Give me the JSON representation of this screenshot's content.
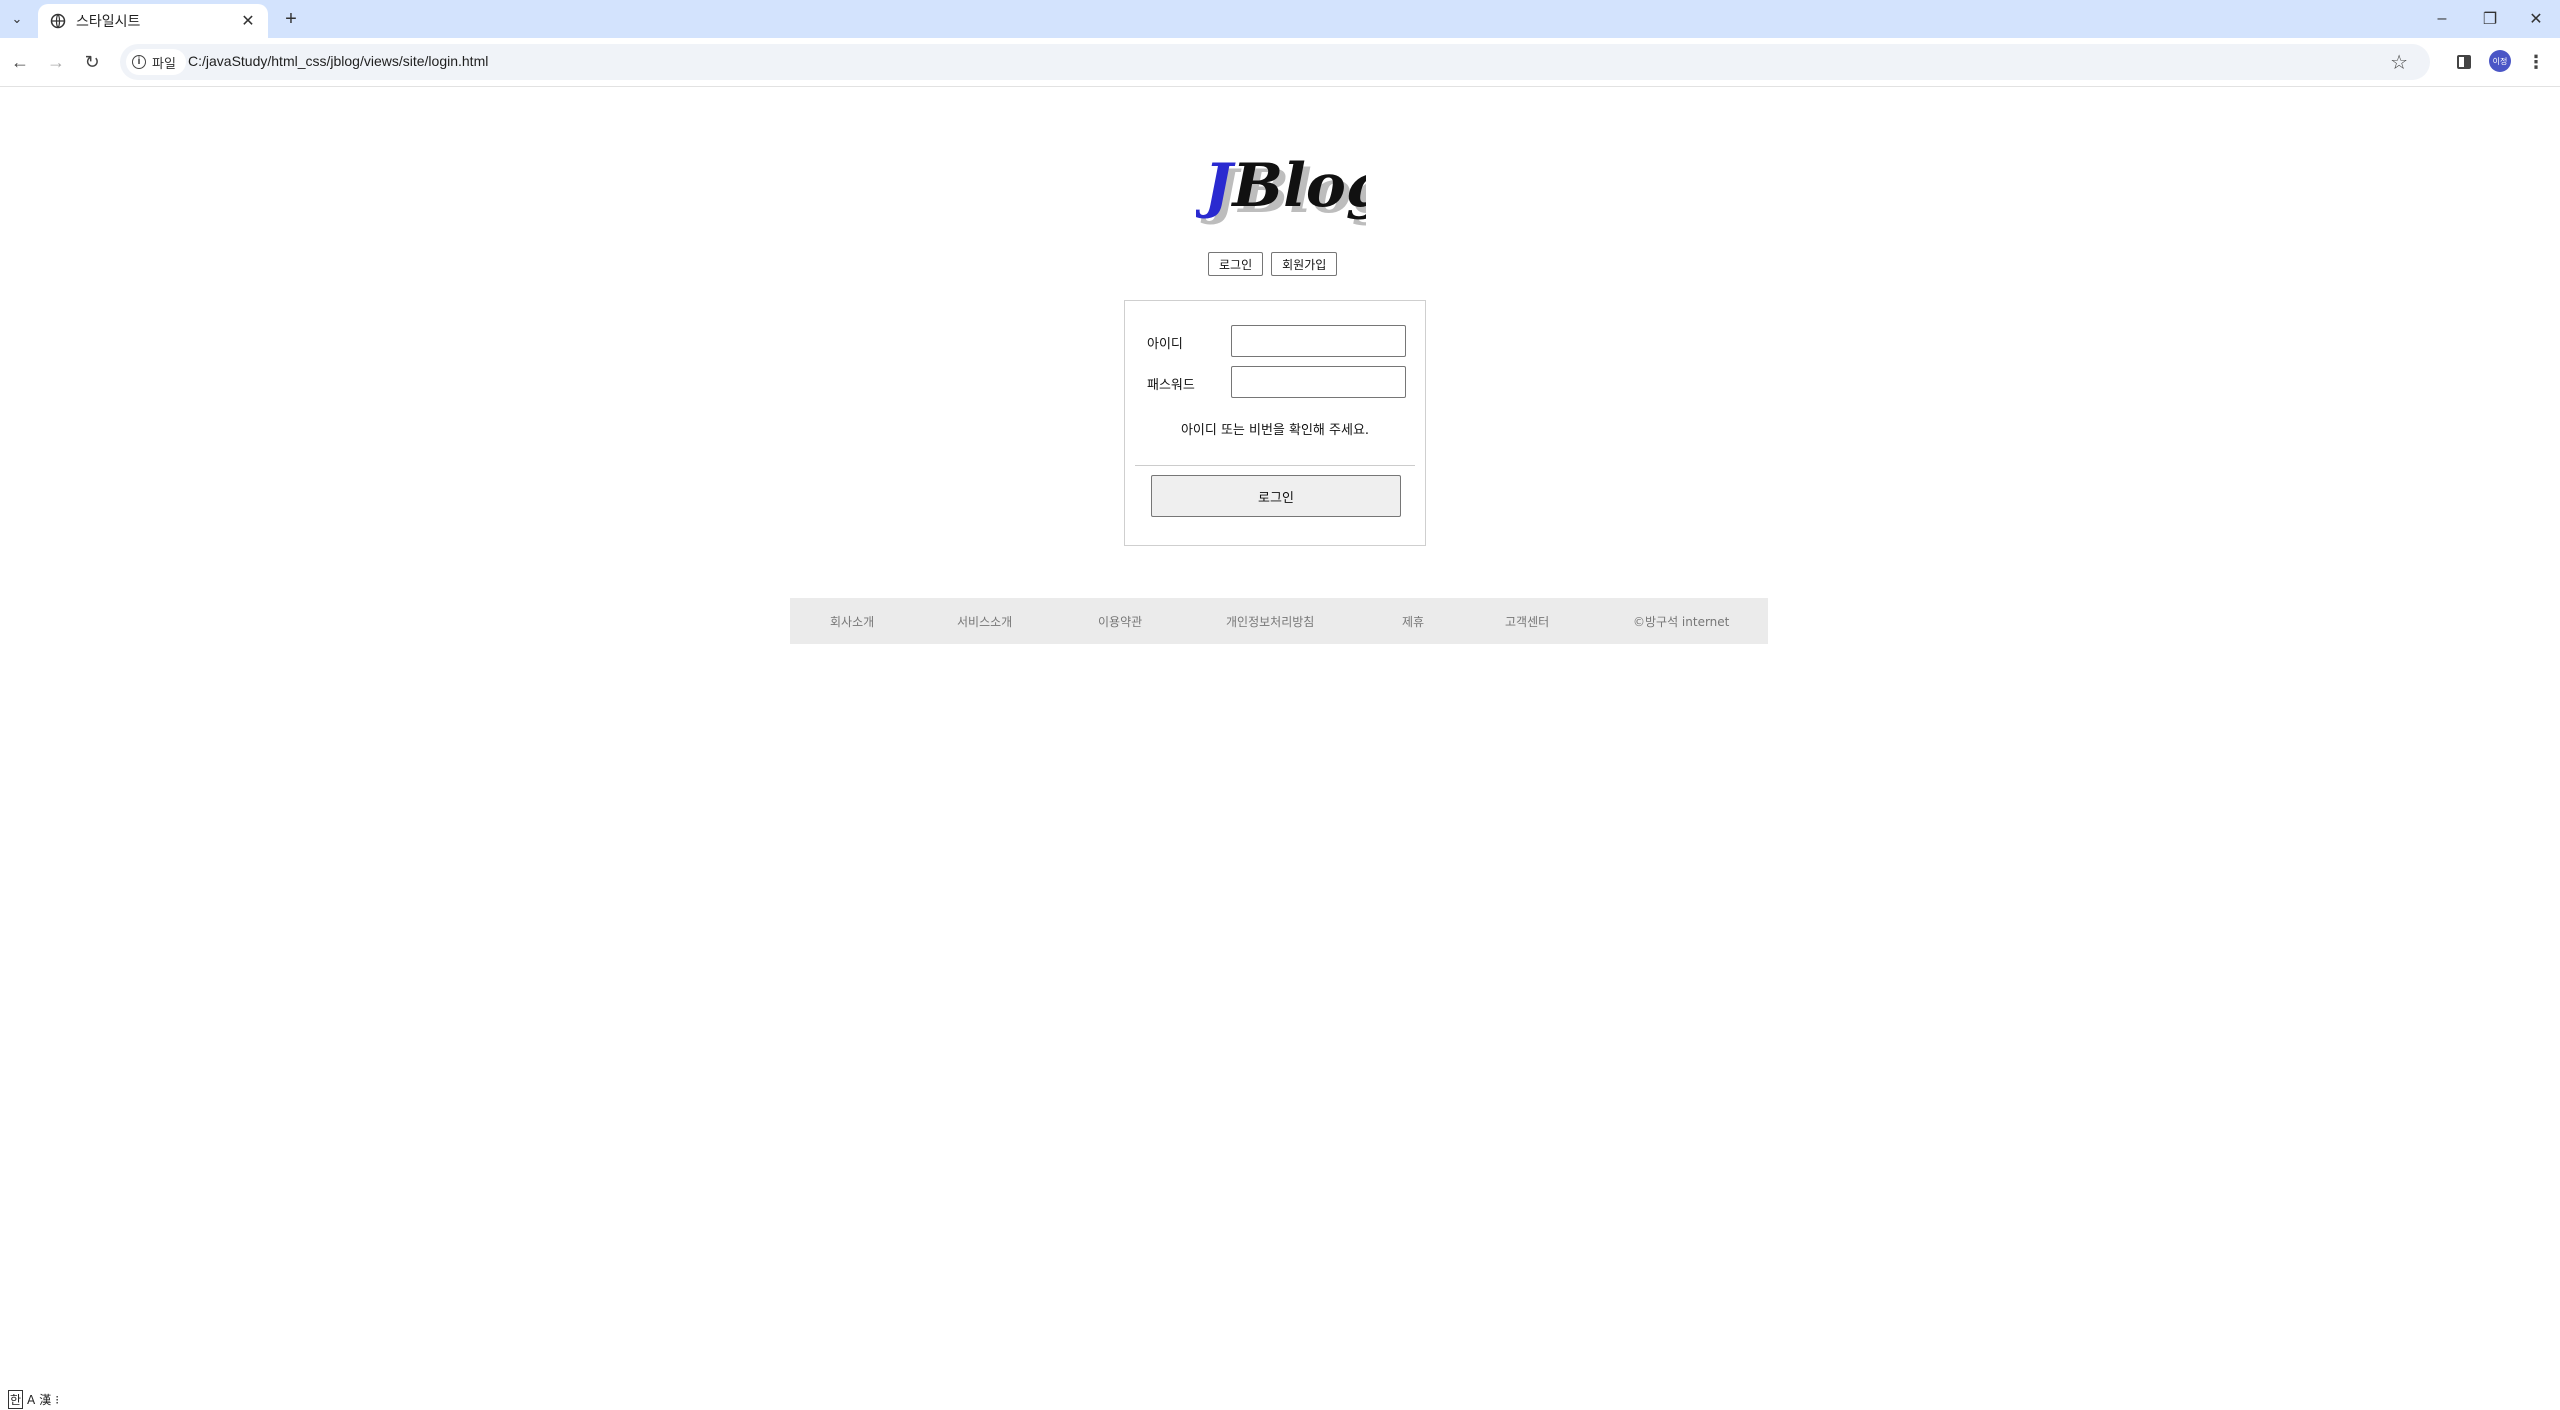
{
  "browser": {
    "tab_title": "스타일시트",
    "url": "C:/javaStudy/html_css/jblog/views/site/login.html",
    "site_chip_label": "파일",
    "profile_initials": "이정",
    "minimize": "–",
    "restore": "❐",
    "close": "✕"
  },
  "header": {
    "logo_text_j": "J",
    "logo_text_rest": "Blog",
    "login_link": "로그인",
    "join_link": "회원가입"
  },
  "login_form": {
    "id_label": "아이디",
    "password_label": "패스워드",
    "id_value": "",
    "password_value": "",
    "error_message": "아이디 또는 비번을 확인해 주세요.",
    "submit_label": "로그인"
  },
  "footer": {
    "links": [
      "회사소개",
      "서비스소개",
      "이용약관",
      "개인정보처리방침",
      "제휴",
      "고객센터",
      "©방구석 internet"
    ]
  },
  "ime": {
    "mode": "한",
    "a": "A",
    "b": "漢"
  },
  "colors": {
    "tabbar_bg": "#d3e3fd",
    "logo_j": "#2a2ad0",
    "footer_bg": "#ebebeb"
  }
}
